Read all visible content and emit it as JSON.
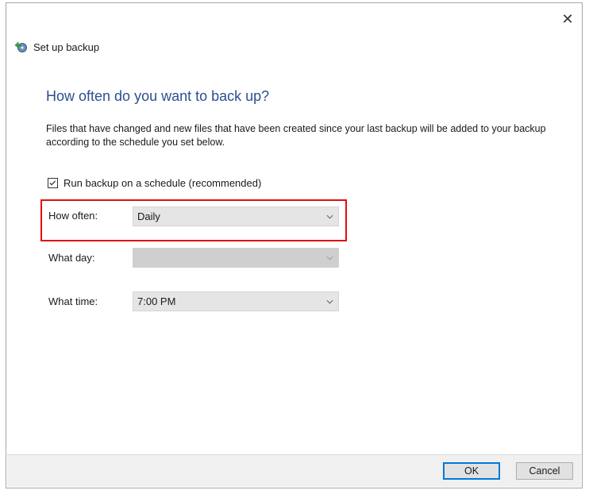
{
  "window": {
    "title": "Set up backup",
    "close_glyph": "✕"
  },
  "page": {
    "heading": "How often do you want to back up?",
    "description": "Files that have changed and new files that have been created since your last backup will be added to your backup according to the schedule you set below."
  },
  "schedule": {
    "checkbox_label": "Run backup on a schedule (recommended)",
    "checked": true,
    "how_often_label": "How often:",
    "how_often_value": "Daily",
    "what_day_label": "What day:",
    "what_day_value": "",
    "what_time_label": "What time:",
    "what_time_value": "7:00 PM"
  },
  "footer": {
    "ok_label": "OK",
    "cancel_label": "Cancel"
  },
  "icons": {
    "title": "backup-icon",
    "close": "close-icon",
    "checkbox": "checkmark-icon",
    "dropdown": "chevron-down-icon"
  },
  "colors": {
    "heading": "#2a4f8f",
    "highlight": "#e01010",
    "ok_border": "#0078d7",
    "footer_bg": "#f0f0f0"
  }
}
